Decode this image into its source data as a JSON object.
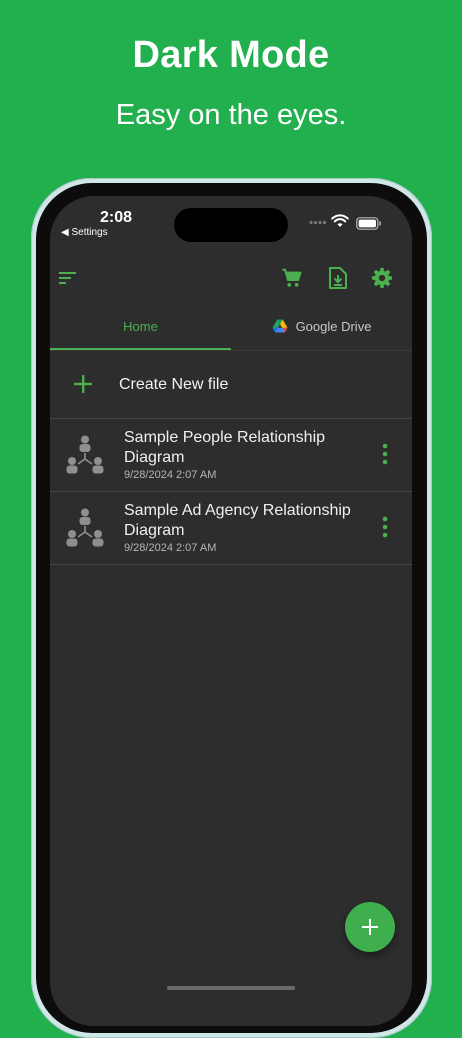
{
  "promo": {
    "headline": "Dark Mode",
    "subheadline": "Easy on the eyes."
  },
  "status_bar": {
    "time": "2:08",
    "back_label": "◀ Settings"
  },
  "toolbar": {
    "menu_icon": "sort-menu-icon",
    "cart_icon": "shopping-cart-icon",
    "import_icon": "file-import-icon",
    "settings_icon": "gear-icon"
  },
  "tabs": [
    {
      "label": "Home",
      "selected": true
    },
    {
      "label": "Google Drive",
      "selected": false
    }
  ],
  "create_new": {
    "label": "Create New file"
  },
  "files": [
    {
      "title": "Sample People Relationship Diagram",
      "date": "9/28/2024 2:07 AM"
    },
    {
      "title": "Sample Ad Agency Relationship Diagram",
      "date": "9/28/2024 2:07 AM"
    }
  ],
  "colors": {
    "background_green": "#22b04f",
    "accent": "#4caf50",
    "screen_bg": "#2d2d2d"
  }
}
